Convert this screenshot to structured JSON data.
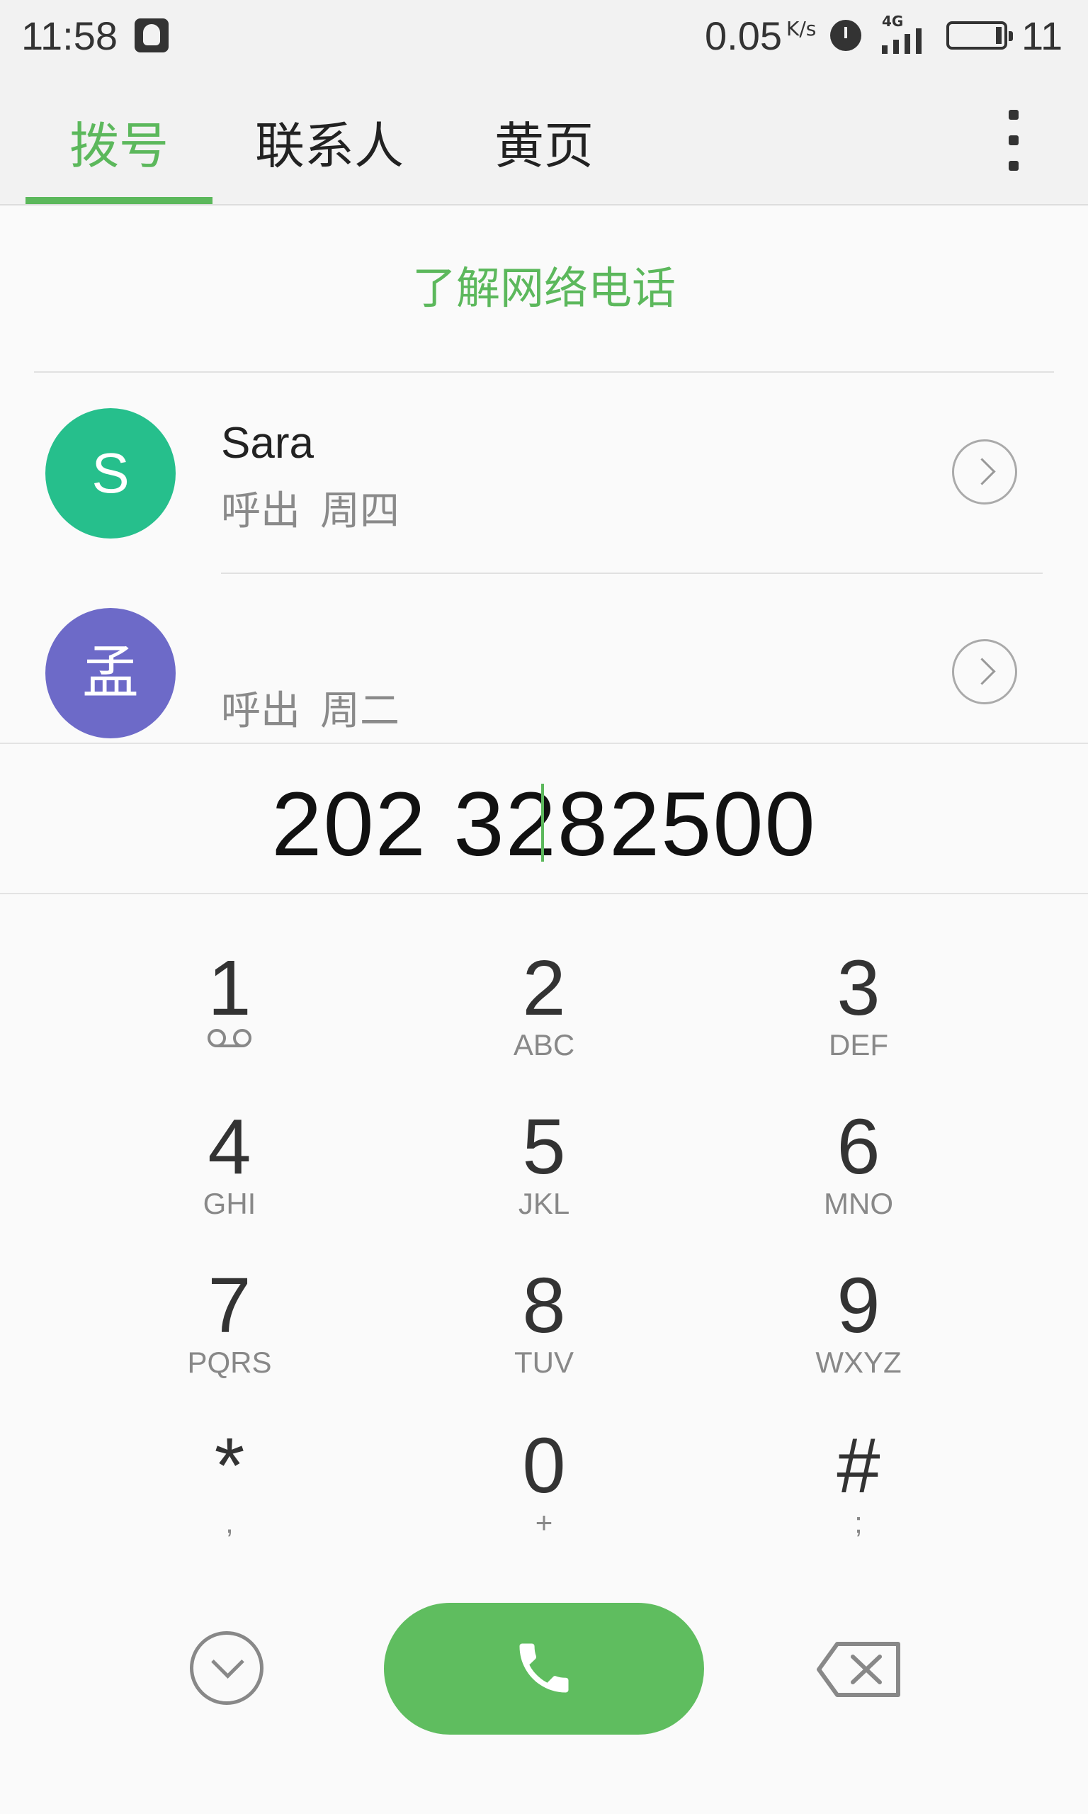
{
  "status_bar": {
    "time": "11:58",
    "net_speed": "0.05",
    "net_speed_unit": "K/s",
    "network_type": "4G",
    "battery": "11"
  },
  "tabs": [
    {
      "label": "拨号",
      "active": true
    },
    {
      "label": "联系人",
      "active": false
    },
    {
      "label": "黄页",
      "active": false
    }
  ],
  "learn_link": "了解网络电话",
  "call_log": [
    {
      "avatar_letter": "S",
      "avatar_color": "#26bf8c",
      "name": "Sara",
      "type": "呼出",
      "day": "周四"
    },
    {
      "avatar_letter": "孟",
      "avatar_color": "#6d6ac8",
      "name": "",
      "type": "呼出",
      "day": "周二"
    }
  ],
  "dial_number": "202  3282500",
  "keypad": [
    {
      "digit": "1",
      "sub": "voicemail-icon"
    },
    {
      "digit": "2",
      "sub": "ABC"
    },
    {
      "digit": "3",
      "sub": "DEF"
    },
    {
      "digit": "4",
      "sub": "GHI"
    },
    {
      "digit": "5",
      "sub": "JKL"
    },
    {
      "digit": "6",
      "sub": "MNO"
    },
    {
      "digit": "7",
      "sub": "PQRS"
    },
    {
      "digit": "8",
      "sub": "TUV"
    },
    {
      "digit": "9",
      "sub": "WXYZ"
    },
    {
      "digit": "*",
      "sub": ","
    },
    {
      "digit": "0",
      "sub": "+"
    },
    {
      "digit": "#",
      "sub": ";"
    }
  ],
  "colors": {
    "accent": "#5cb85c",
    "call_button": "#5fbd5f"
  }
}
